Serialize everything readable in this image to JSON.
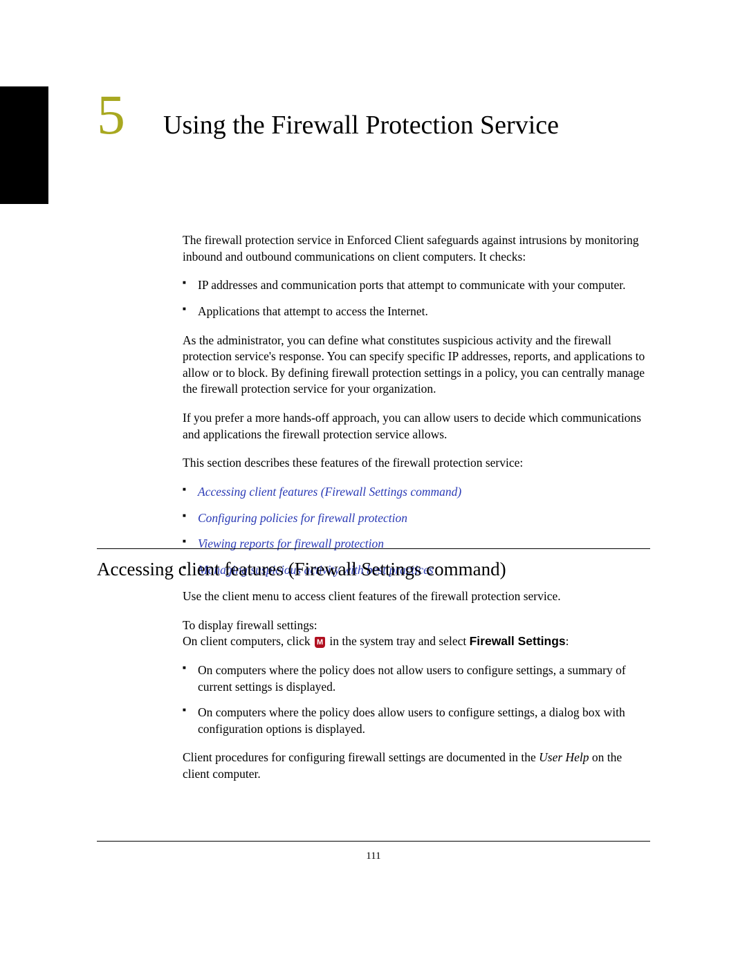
{
  "chapter": {
    "number": "5",
    "title": "Using the Firewall Protection Service"
  },
  "intro": {
    "p1": "The firewall protection service in Enforced Client safeguards against intrusions by monitoring inbound and outbound communications on client computers. It checks:",
    "bullets": [
      "IP addresses and communication ports that attempt to communicate with your computer.",
      "Applications that attempt to access the Internet."
    ],
    "p2": "As the administrator, you can define what constitutes suspicious activity and the firewall protection service's response. You can specify specific IP addresses, reports, and applications to allow or to block. By defining firewall protection settings in a policy, you can centrally manage the firewall protection service for your organization.",
    "p3": "If you prefer a more hands-off approach, you can allow users to decide which communications and applications the firewall protection service allows.",
    "p4": "This section describes these features of the firewall protection service:",
    "links": [
      "Accessing client features (Firewall Settings command)",
      "Configuring policies for firewall protection",
      "Viewing reports for firewall protection",
      "Managing suspicious activity with best practices"
    ]
  },
  "section": {
    "heading": "Accessing client features (Firewall Settings command)",
    "p1": "Use the client menu to access client features of the firewall protection service.",
    "p2a": "To display firewall settings:",
    "p2b_before": "On client computers, click ",
    "p2b_after": " in the system tray and select ",
    "p2b_bold": "Firewall Settings",
    "p2b_end": ":",
    "bullets": [
      "On computers where the policy does not allow users to configure settings, a summary of current settings is displayed.",
      "On computers where the policy does allow users to configure settings, a dialog box with configuration options is displayed."
    ],
    "p3_before": "Client procedures for configuring firewall settings are documented in the ",
    "p3_italic": "User Help",
    "p3_after": " on the client computer."
  },
  "icon": {
    "glyph": "M"
  },
  "page_number": "111"
}
